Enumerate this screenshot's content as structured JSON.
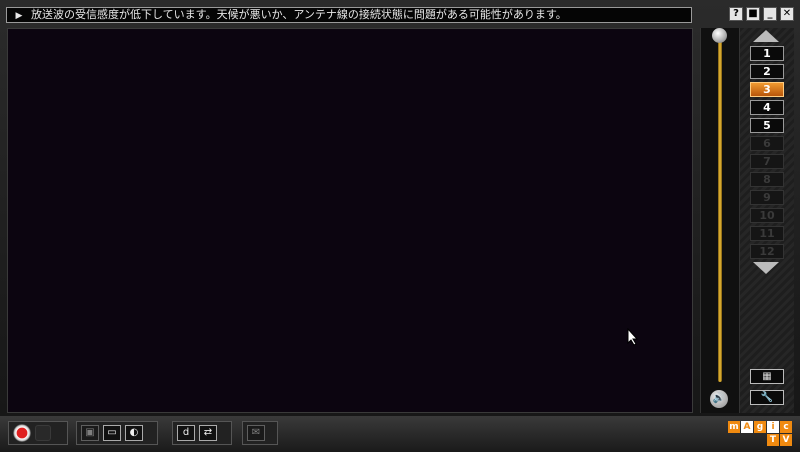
{
  "status": {
    "play_glyph": "▶",
    "message": "放送波の受信感度が低下しています。天候が悪いか、アンテナ線の接続状態に問題がある可能性があります。"
  },
  "window_buttons": {
    "help": "?",
    "pin": "■",
    "minimize": "_",
    "close": "✕"
  },
  "channels": {
    "up_arrow": "▲",
    "down_arrow": "▼",
    "items": [
      {
        "label": "1",
        "state": "enabled"
      },
      {
        "label": "2",
        "state": "enabled"
      },
      {
        "label": "3",
        "state": "active"
      },
      {
        "label": "4",
        "state": "enabled"
      },
      {
        "label": "5",
        "state": "enabled"
      },
      {
        "label": "6",
        "state": "disabled"
      },
      {
        "label": "7",
        "state": "disabled"
      },
      {
        "label": "8",
        "state": "disabled"
      },
      {
        "label": "9",
        "state": "disabled"
      },
      {
        "label": "10",
        "state": "disabled"
      },
      {
        "label": "11",
        "state": "disabled"
      },
      {
        "label": "12",
        "state": "disabled"
      }
    ],
    "guide_icon": "▦",
    "settings_icon": "🔧"
  },
  "volume": {
    "level": 1.0,
    "icon": "🔊"
  },
  "toolbar": {
    "record_icon": "record-icon",
    "stop_icon": "stop-icon",
    "btn_view1": "▣",
    "btn_view2": "▭",
    "btn_view3": "◐",
    "btn_data": "d",
    "btn_switch": "⇄",
    "btn_mail": "✉"
  },
  "logo": {
    "top": [
      "m",
      "A",
      "g",
      "i",
      "c"
    ],
    "bottom": [
      "",
      "",
      "",
      "T",
      "V"
    ]
  },
  "colors": {
    "accent": "#f08a10",
    "video_bg": "#0c0510",
    "volume_bar": "#f2c23a"
  }
}
